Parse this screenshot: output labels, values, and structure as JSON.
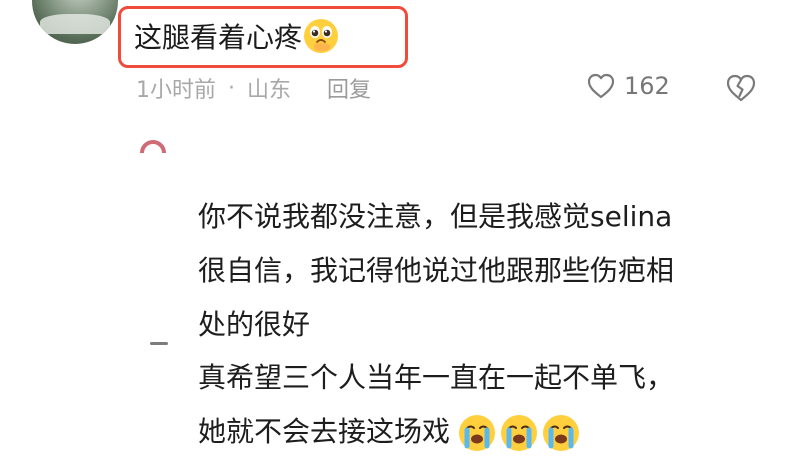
{
  "comment": {
    "text": "这腿看着心疼",
    "emoji": "pleading-face-emoji"
  },
  "meta": {
    "time": "1小时前",
    "separator": "·",
    "location": "山东",
    "reply_label": "回复"
  },
  "actions": {
    "like_count": "162"
  },
  "replies": [
    {
      "lines": [
        "你不说我都没注意，但是我感觉selina",
        "很自信，我记得他说过他跟那些伤疤相",
        "处的很好"
      ]
    },
    {
      "lines": [
        "真希望三个人当年一直在一起不单飞，",
        "她就不会去接这场戏"
      ],
      "emojis": [
        "crying-face-emoji",
        "crying-face-emoji",
        "crying-face-emoji"
      ]
    }
  ],
  "colors": {
    "highlight_border": "#f04b3c",
    "text_primary": "#1d1d1d",
    "text_secondary": "#a8a8a8",
    "emoji_yellow": "#ffcf3d",
    "tear_blue": "#5ab8f0"
  },
  "icons": {
    "heart": "heart-icon",
    "broken_heart": "broken-heart-icon"
  }
}
